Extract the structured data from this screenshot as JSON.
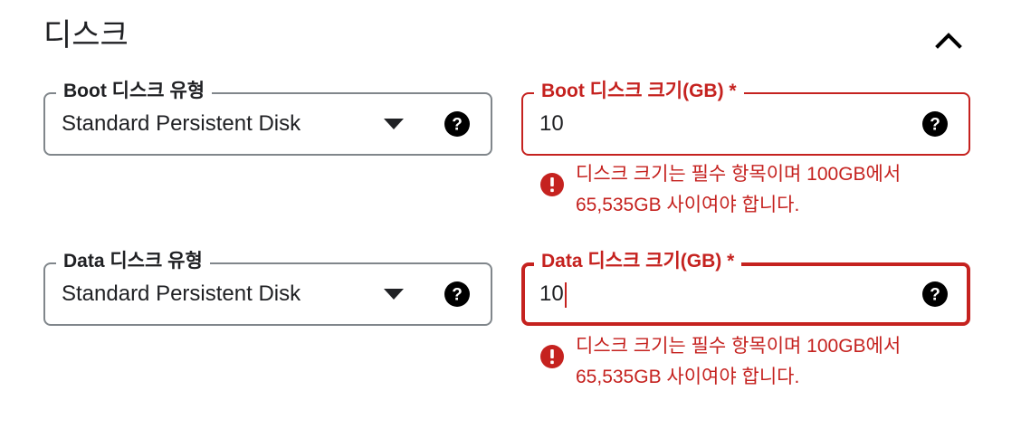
{
  "section": {
    "title": "디스크",
    "collapse_icon": "chevron-up-icon"
  },
  "boot_disk_type": {
    "label": "Boot 디스크 유형",
    "value": "Standard Persistent Disk",
    "icons": [
      "dropdown-arrow-icon",
      "help-icon"
    ]
  },
  "boot_disk_size": {
    "label": "Boot 디스크 크기(GB) *",
    "value": "10",
    "state": "error",
    "error_message": "디스크 크기는 필수 항목이며 100GB에서 65,535GB 사이여야 합니다.",
    "icons": [
      "help-icon",
      "error-icon"
    ]
  },
  "data_disk_type": {
    "label": "Data 디스크 유형",
    "value": "Standard Persistent Disk",
    "icons": [
      "dropdown-arrow-icon",
      "help-icon"
    ]
  },
  "data_disk_size": {
    "label": "Data 디스크 크기(GB) *",
    "value": "10",
    "state": "error-focused",
    "error_message": "디스크 크기는 필수 항목이며 100GB에서 65,535GB 사이여야 합니다.",
    "icons": [
      "help-icon",
      "error-icon"
    ]
  },
  "colors": {
    "error": "#c5221f",
    "border": "#80868b",
    "text": "#202124"
  }
}
